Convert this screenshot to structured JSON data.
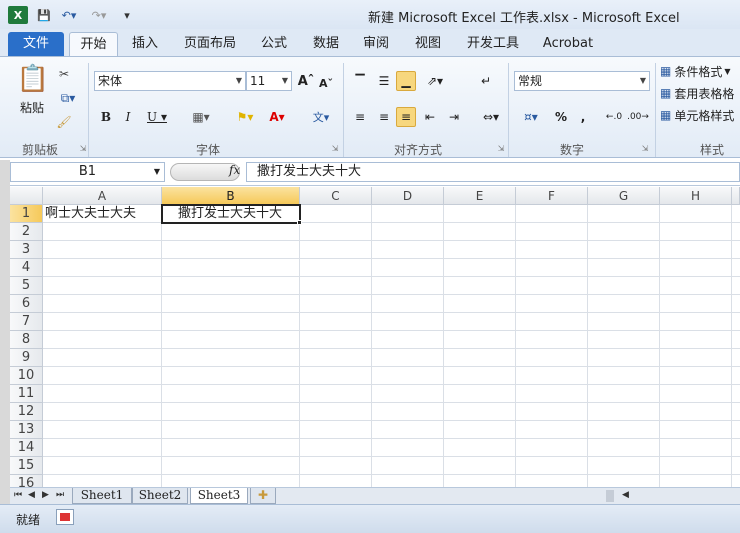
{
  "window": {
    "title": "新建 Microsoft Excel 工作表.xlsx  -  Microsoft Excel"
  },
  "tabs": [
    "文件",
    "开始",
    "插入",
    "页面布局",
    "公式",
    "数据",
    "审阅",
    "视图",
    "开发工具",
    "Acrobat"
  ],
  "ribbon": {
    "clipboard": {
      "label": "剪贴板",
      "paste": "粘贴"
    },
    "font": {
      "label": "字体",
      "name": "宋体",
      "size": "11"
    },
    "alignment": {
      "label": "对齐方式"
    },
    "number": {
      "label": "数字",
      "format": "常规"
    },
    "styles": {
      "label": "样式",
      "conditional": "条件格式",
      "table": "套用表格格",
      "cell": "单元格样式"
    }
  },
  "formula_bar": {
    "name_box": "B1",
    "fx": "fx",
    "value": "撒打发士大夫十大"
  },
  "columns": [
    "A",
    "B",
    "C",
    "D",
    "E",
    "F",
    "G",
    "H"
  ],
  "rows": [
    "1",
    "2",
    "3",
    "4",
    "5",
    "6",
    "7",
    "8",
    "9",
    "10",
    "11",
    "12",
    "13",
    "14",
    "15",
    "16"
  ],
  "cells": {
    "A1": "啊士大夫士大夫",
    "B1": "撒打发士大夫十大"
  },
  "sheets": [
    "Sheet1",
    "Sheet2",
    "Sheet3"
  ],
  "status": "就绪",
  "colors": {
    "file_tab": "#2a6fc9",
    "selection_header": "#f6c95a"
  }
}
